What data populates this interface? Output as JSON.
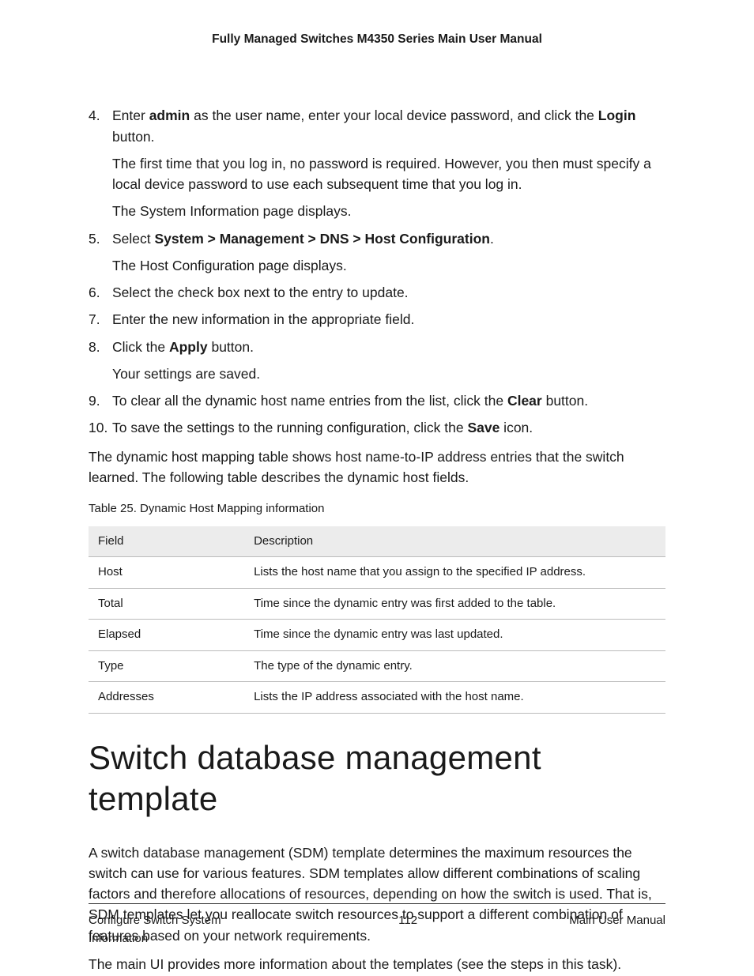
{
  "header": {
    "title": "Fully Managed Switches M4350 Series Main User Manual"
  },
  "steps": {
    "s4": {
      "line1_a": "Enter ",
      "line1_b": "admin",
      "line1_c": " as the user name, enter your local device password, and click the ",
      "line1_d": "Login",
      "line1_e": " button.",
      "detail1": "The first time that you log in, no password is required. However, you then must specify a local device password to use each subsequent time that you log in.",
      "detail2": "The System Information page displays."
    },
    "s5": {
      "line1_a": "Select ",
      "line1_b": "System > Management > DNS > Host Configuration",
      "line1_c": ".",
      "detail1": "The Host Configuration page displays."
    },
    "s6": {
      "line1": "Select the check box next to the entry to update."
    },
    "s7": {
      "line1": "Enter the new information in the appropriate field."
    },
    "s8": {
      "line1_a": "Click the ",
      "line1_b": "Apply",
      "line1_c": " button.",
      "detail1": "Your settings are saved."
    },
    "s9": {
      "line1_a": "To clear all the dynamic host name entries from the list, click the ",
      "line1_b": "Clear",
      "line1_c": " button."
    },
    "s10": {
      "line1_a": "To save the settings to the running configuration, click the ",
      "line1_b": "Save",
      "line1_c": " icon."
    }
  },
  "para_after_steps": "The dynamic host mapping table shows host name-to-IP address entries that the switch learned. The following table describes the dynamic host fields.",
  "table": {
    "caption": "Table 25. Dynamic Host Mapping information",
    "head": {
      "c1": "Field",
      "c2": "Description"
    },
    "rows": [
      {
        "c1": "Host",
        "c2": "Lists the host name that you assign to the specified IP address."
      },
      {
        "c1": "Total",
        "c2": "Time since the dynamic entry was first added to the table."
      },
      {
        "c1": "Elapsed",
        "c2": "Time since the dynamic entry was last updated."
      },
      {
        "c1": "Type",
        "c2": "The type of the dynamic entry."
      },
      {
        "c1": "Addresses",
        "c2": "Lists the IP address associated with the host name."
      }
    ]
  },
  "section": {
    "title": "Switch database management template",
    "para1": "A switch database management (SDM) template determines the maximum resources the switch can use for various features. SDM templates allow different combinations of scaling factors and therefore allocations of resources, depending on how the switch is used. That is, SDM templates let you reallocate switch resources to support a different combination of features based on your network requirements.",
    "para2": "The main UI provides more information about the templates (see the steps in this task)."
  },
  "footer": {
    "left": "Configure Switch System Information",
    "center": "112",
    "right": "Main User Manual"
  }
}
